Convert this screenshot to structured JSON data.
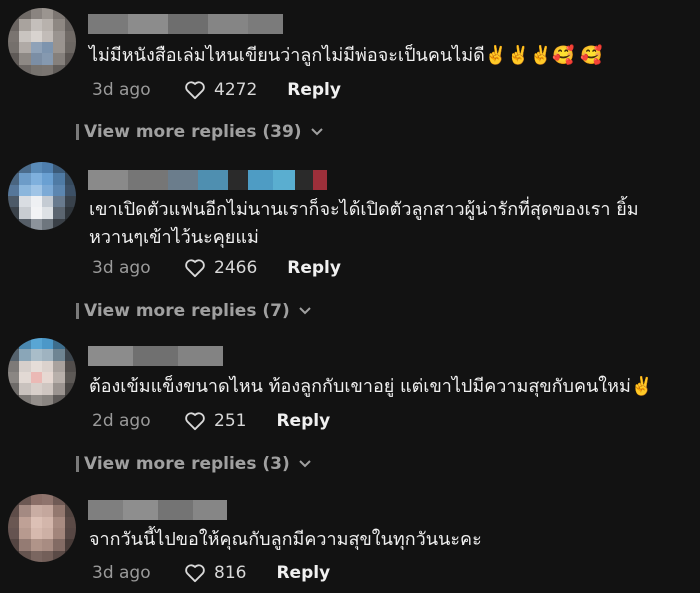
{
  "comments": [
    {
      "text": "ไม่มีหนังสือเล่มไหนเขียนว่าลูกไม่มีพ่อจะเป็นคนไม่ดี✌️✌️✌️🥰 🥰",
      "time": "3d ago",
      "likes": "4272",
      "reply_label": "Reply",
      "view_more": "View more replies (39)"
    },
    {
      "text": "เขาเปิดตัวแฟนอีกไม่นานเราก็จะได้เปิดตัวลูกสาวผู้น่ารักที่สุดของเรา ยิ้มหวานๆเข้าไว้นะคุยแม่",
      "time": "3d ago",
      "likes": "2466",
      "reply_label": "Reply",
      "view_more": "View more replies (7)"
    },
    {
      "text": "ต้องเข้มแข็งขนาดไหน ท้องลูกกับเขาอยู่ แต่เขาไปมีความสุขกับคนใหม่✌️",
      "time": "2d ago",
      "likes": "251",
      "reply_label": "Reply",
      "view_more": "View more replies (3)"
    },
    {
      "text": "จากวันนี้ไปขอให้คุณกับลูกมีความสุขในทุกวันนะคะ",
      "time": "3d ago",
      "likes": "816",
      "reply_label": "Reply"
    }
  ],
  "icons": {
    "like": "heart-icon",
    "expand": "chevron-down-icon"
  },
  "colors": {
    "background": "#121212",
    "muted": "#9a9a9a",
    "text": "#f0f0f0"
  }
}
